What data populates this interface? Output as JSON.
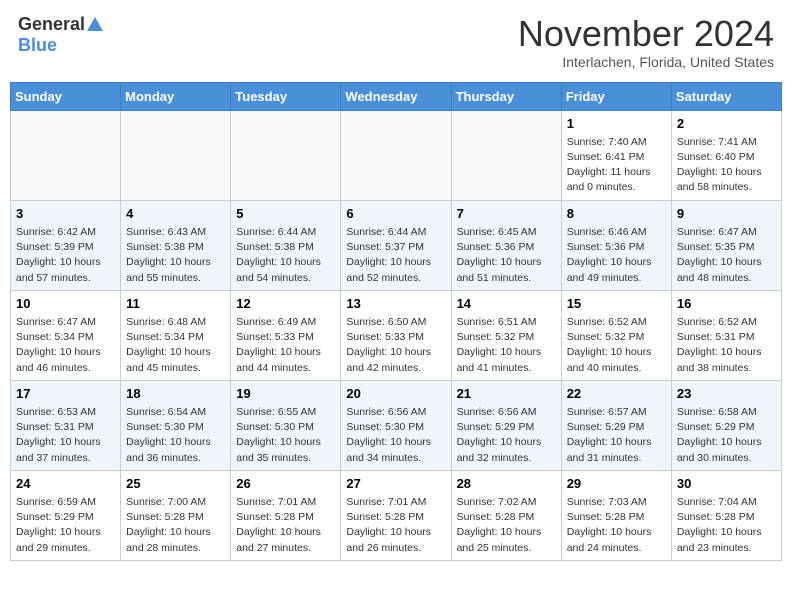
{
  "logo": {
    "general": "General",
    "blue": "Blue"
  },
  "header": {
    "month": "November 2024",
    "location": "Interlachen, Florida, United States"
  },
  "weekdays": [
    "Sunday",
    "Monday",
    "Tuesday",
    "Wednesday",
    "Thursday",
    "Friday",
    "Saturday"
  ],
  "weeks": [
    {
      "days": [
        {
          "num": "",
          "info": ""
        },
        {
          "num": "",
          "info": ""
        },
        {
          "num": "",
          "info": ""
        },
        {
          "num": "",
          "info": ""
        },
        {
          "num": "",
          "info": ""
        },
        {
          "num": "1",
          "info": "Sunrise: 7:40 AM\nSunset: 6:41 PM\nDaylight: 11 hours\nand 0 minutes."
        },
        {
          "num": "2",
          "info": "Sunrise: 7:41 AM\nSunset: 6:40 PM\nDaylight: 10 hours\nand 58 minutes."
        }
      ]
    },
    {
      "days": [
        {
          "num": "3",
          "info": "Sunrise: 6:42 AM\nSunset: 5:39 PM\nDaylight: 10 hours\nand 57 minutes."
        },
        {
          "num": "4",
          "info": "Sunrise: 6:43 AM\nSunset: 5:38 PM\nDaylight: 10 hours\nand 55 minutes."
        },
        {
          "num": "5",
          "info": "Sunrise: 6:44 AM\nSunset: 5:38 PM\nDaylight: 10 hours\nand 54 minutes."
        },
        {
          "num": "6",
          "info": "Sunrise: 6:44 AM\nSunset: 5:37 PM\nDaylight: 10 hours\nand 52 minutes."
        },
        {
          "num": "7",
          "info": "Sunrise: 6:45 AM\nSunset: 5:36 PM\nDaylight: 10 hours\nand 51 minutes."
        },
        {
          "num": "8",
          "info": "Sunrise: 6:46 AM\nSunset: 5:36 PM\nDaylight: 10 hours\nand 49 minutes."
        },
        {
          "num": "9",
          "info": "Sunrise: 6:47 AM\nSunset: 5:35 PM\nDaylight: 10 hours\nand 48 minutes."
        }
      ]
    },
    {
      "days": [
        {
          "num": "10",
          "info": "Sunrise: 6:47 AM\nSunset: 5:34 PM\nDaylight: 10 hours\nand 46 minutes."
        },
        {
          "num": "11",
          "info": "Sunrise: 6:48 AM\nSunset: 5:34 PM\nDaylight: 10 hours\nand 45 minutes."
        },
        {
          "num": "12",
          "info": "Sunrise: 6:49 AM\nSunset: 5:33 PM\nDaylight: 10 hours\nand 44 minutes."
        },
        {
          "num": "13",
          "info": "Sunrise: 6:50 AM\nSunset: 5:33 PM\nDaylight: 10 hours\nand 42 minutes."
        },
        {
          "num": "14",
          "info": "Sunrise: 6:51 AM\nSunset: 5:32 PM\nDaylight: 10 hours\nand 41 minutes."
        },
        {
          "num": "15",
          "info": "Sunrise: 6:52 AM\nSunset: 5:32 PM\nDaylight: 10 hours\nand 40 minutes."
        },
        {
          "num": "16",
          "info": "Sunrise: 6:52 AM\nSunset: 5:31 PM\nDaylight: 10 hours\nand 38 minutes."
        }
      ]
    },
    {
      "days": [
        {
          "num": "17",
          "info": "Sunrise: 6:53 AM\nSunset: 5:31 PM\nDaylight: 10 hours\nand 37 minutes."
        },
        {
          "num": "18",
          "info": "Sunrise: 6:54 AM\nSunset: 5:30 PM\nDaylight: 10 hours\nand 36 minutes."
        },
        {
          "num": "19",
          "info": "Sunrise: 6:55 AM\nSunset: 5:30 PM\nDaylight: 10 hours\nand 35 minutes."
        },
        {
          "num": "20",
          "info": "Sunrise: 6:56 AM\nSunset: 5:30 PM\nDaylight: 10 hours\nand 34 minutes."
        },
        {
          "num": "21",
          "info": "Sunrise: 6:56 AM\nSunset: 5:29 PM\nDaylight: 10 hours\nand 32 minutes."
        },
        {
          "num": "22",
          "info": "Sunrise: 6:57 AM\nSunset: 5:29 PM\nDaylight: 10 hours\nand 31 minutes."
        },
        {
          "num": "23",
          "info": "Sunrise: 6:58 AM\nSunset: 5:29 PM\nDaylight: 10 hours\nand 30 minutes."
        }
      ]
    },
    {
      "days": [
        {
          "num": "24",
          "info": "Sunrise: 6:59 AM\nSunset: 5:29 PM\nDaylight: 10 hours\nand 29 minutes."
        },
        {
          "num": "25",
          "info": "Sunrise: 7:00 AM\nSunset: 5:28 PM\nDaylight: 10 hours\nand 28 minutes."
        },
        {
          "num": "26",
          "info": "Sunrise: 7:01 AM\nSunset: 5:28 PM\nDaylight: 10 hours\nand 27 minutes."
        },
        {
          "num": "27",
          "info": "Sunrise: 7:01 AM\nSunset: 5:28 PM\nDaylight: 10 hours\nand 26 minutes."
        },
        {
          "num": "28",
          "info": "Sunrise: 7:02 AM\nSunset: 5:28 PM\nDaylight: 10 hours\nand 25 minutes."
        },
        {
          "num": "29",
          "info": "Sunrise: 7:03 AM\nSunset: 5:28 PM\nDaylight: 10 hours\nand 24 minutes."
        },
        {
          "num": "30",
          "info": "Sunrise: 7:04 AM\nSunset: 5:28 PM\nDaylight: 10 hours\nand 23 minutes."
        }
      ]
    }
  ]
}
